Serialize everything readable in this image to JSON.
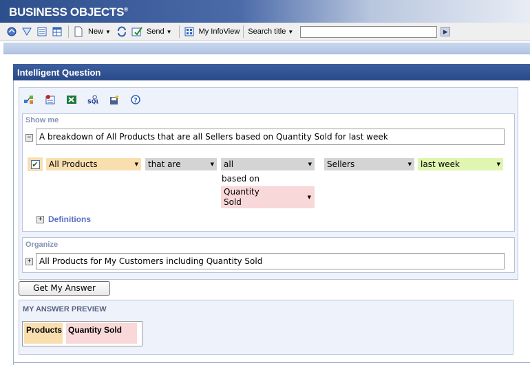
{
  "banner": {
    "logo": "BUSINESS OBJECTS",
    "logo_mark": "®"
  },
  "toolbar": {
    "new_label": "New",
    "send_label": "Send",
    "infoview_label": "My InfoView",
    "search_label": "Search title",
    "search_value": "",
    "icons": [
      "home-icon",
      "favorites-icon",
      "list-view-icon",
      "details-view-icon",
      "document-icon",
      "refresh-icon",
      "send-icon",
      "infoview-icon",
      "go-arrow-icon"
    ]
  },
  "panel": {
    "title": "Intelligent Question"
  },
  "tool_icons": [
    "query-panel-icon",
    "report-icon",
    "excel-icon",
    "sql-icon",
    "save-icon",
    "help-icon"
  ],
  "show_me": {
    "label": "Show me",
    "toggle": "−",
    "sentence": "A breakdown of All Products that are all Sellers based on Quantity Sold for last week",
    "checked": true,
    "dropdowns": {
      "products": "All Products",
      "that_are": "that are",
      "all": "all",
      "sellers": "Sellers",
      "last_week": "last week",
      "based_on": "based on",
      "quantity_sold": "Quantity Sold"
    },
    "definitions_toggle": "+",
    "definitions_label": "Definitions"
  },
  "organize": {
    "label": "Organize",
    "toggle": "+",
    "sentence": "All Products for My Customers including Quantity Sold"
  },
  "get_answer_button": "Get My Answer",
  "preview": {
    "label": "MY ANSWER PREVIEW",
    "columns": [
      "Products",
      "Quantity Sold"
    ]
  },
  "colors": {
    "products_bg": "#f9dfb0",
    "quantity_bg": "#f8d8d8",
    "time_bg": "#dff5b0",
    "neutral_bg": "#d4d4d4",
    "header_blue": "#2d4f8c"
  }
}
